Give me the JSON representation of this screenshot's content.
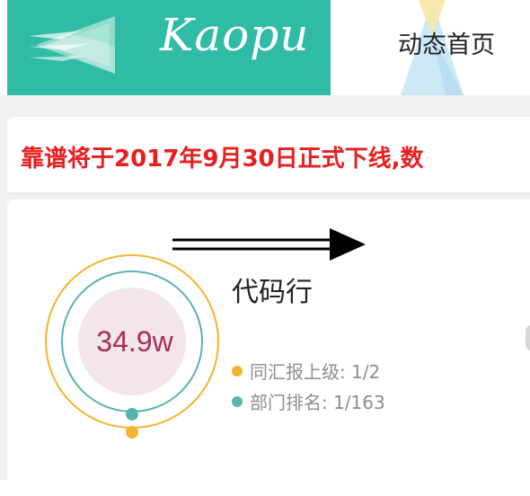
{
  "header": {
    "logo_text": "Kaopu",
    "nav": {
      "home_label": "动态首页"
    }
  },
  "notice": {
    "text": "靠谱将于2017年9月30日正式下线,数"
  },
  "stat_card": {
    "value": "34.9w",
    "title": "代码行",
    "legend": [
      {
        "label": "同汇报上级: 1/2",
        "color": "#f2b531"
      },
      {
        "label": "部门排名: 1/163",
        "color": "#5ab3b0"
      }
    ]
  },
  "colors": {
    "brand": "#2fbba5",
    "notice_red": "#e81f1f",
    "value_text": "#a72d5b",
    "outer_ring": "#f2b531",
    "inner_ring": "#5ab3b0",
    "center_fill": "#f3e5ea"
  },
  "icons": {
    "logo": "layered-arrow-logo-icon",
    "arrow": "double-arrow-right-icon",
    "decor": "triangle-decor-icon"
  }
}
